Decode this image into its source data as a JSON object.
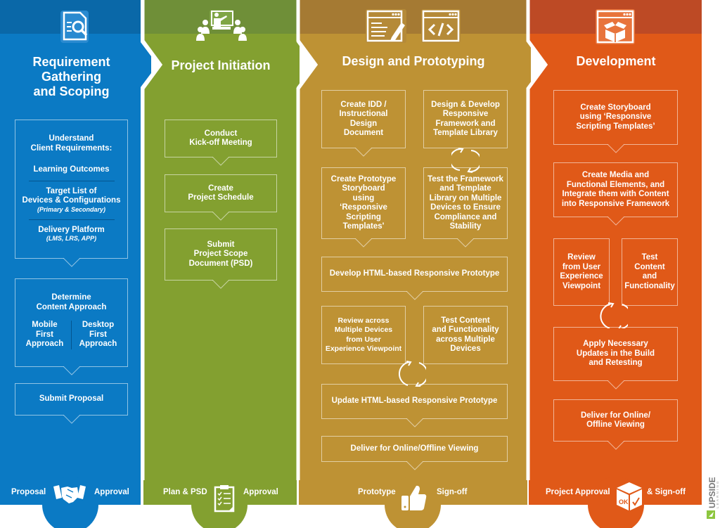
{
  "colors": {
    "blue": "#0b7ac4",
    "blue_band": "#0a68a8",
    "green": "#83a030",
    "green_band": "#6f8f38",
    "gold": "#be9234",
    "gold_band": "#a57a33",
    "orange": "#e05918",
    "orange_band": "#bd4a25",
    "logo_green": "#8dc63f",
    "logo_gray": "#888888"
  },
  "phases": [
    {
      "title_lines": [
        "Requirement",
        "Gathering",
        "and Scoping"
      ],
      "icon": "document-search-icon",
      "boxes": [
        {
          "heading": [
            "Understand",
            "Client Requirements:"
          ],
          "items": [
            {
              "label": [
                "Learning Outcomes"
              ]
            },
            {
              "label": [
                "Target List of",
                "Devices & Configurations"
              ],
              "note": "(Primary & Secondary)"
            },
            {
              "label": [
                "Delivery Platform"
              ],
              "note": "(LMS, LRS, APP)"
            }
          ]
        },
        {
          "heading": [
            "Determine",
            "Content Approach"
          ],
          "options": [
            [
              "Mobile",
              "First",
              "Approach"
            ],
            [
              "Desktop",
              "First",
              "Approach"
            ]
          ]
        },
        {
          "label": [
            "Submit Proposal"
          ]
        }
      ],
      "footer": {
        "left": "Proposal",
        "right": "Approval",
        "icon": "handshake-icon"
      }
    },
    {
      "title_lines": [
        "Project Initiation"
      ],
      "icon": "presentation-meeting-icon",
      "boxes": [
        {
          "label": [
            "Conduct",
            "Kick-off Meeting"
          ]
        },
        {
          "label": [
            "Create",
            "Project Schedule"
          ]
        },
        {
          "label": [
            "Submit",
            "Project Scope",
            "Document (PSD)"
          ]
        }
      ],
      "footer": {
        "left": "Plan & PSD",
        "right": "Approval",
        "icon": "clipboard-checklist-icon"
      }
    },
    {
      "title_lines": [
        "Design and Prototyping"
      ],
      "icons": [
        "design-window-pencil-icon",
        "code-window-icon"
      ],
      "boxes": [
        {
          "label": [
            "Create IDD /",
            "Instructional",
            "Design",
            "Document"
          ]
        },
        {
          "label": [
            "Design & Develop",
            "Responsive",
            "Framework and",
            "Template Library"
          ]
        },
        {
          "label": [
            "Create Prototype",
            "Storyboard",
            "using",
            "‘Responsive",
            "Scripting",
            "Templates'"
          ]
        },
        {
          "label": [
            "Test the Framework",
            "and Template",
            "Library on Multiple",
            "Devices to Ensure",
            "Compliance and",
            "Stability"
          ]
        },
        {
          "label": [
            "Develop HTML-based Responsive Prototype"
          ]
        },
        {
          "label": [
            "Review across",
            "Multiple Devices",
            "from User",
            "Experience Viewpoint"
          ]
        },
        {
          "label": [
            "Test Content",
            "and Functionality",
            "across Multiple",
            "Devices"
          ]
        },
        {
          "label": [
            "Update HTML-based Responsive Prototype"
          ]
        },
        {
          "label": [
            "Deliver for Online/Offline Viewing"
          ]
        }
      ],
      "footer": {
        "left": "Prototype",
        "right": "Sign-off",
        "icon": "thumbs-up-icon"
      }
    },
    {
      "title_lines": [
        "Development"
      ],
      "icon": "package-window-icon",
      "boxes": [
        {
          "label": [
            "Create Storyboard",
            "using ‘Responsive",
            "Scripting Templates’"
          ]
        },
        {
          "label": [
            "Create Media and",
            "Functional Elements, and",
            "Integrate them with Content",
            "into Responsive Framework"
          ]
        },
        {
          "label": [
            "Review",
            "from User",
            "Experience",
            "Viewpoint"
          ]
        },
        {
          "label": [
            "Test",
            "Content",
            "and",
            "Functionality"
          ]
        },
        {
          "label": [
            "Apply Necessary",
            "Updates in the Build",
            "and Retesting"
          ]
        },
        {
          "label": [
            "Deliver for Online/",
            "Offline Viewing"
          ]
        }
      ],
      "footer": {
        "left": "Project Approval",
        "right": "& Sign-off",
        "icon": "ok-check-box-icon"
      }
    }
  ],
  "logo": {
    "name": "UPSIDE",
    "sub": "LEARNING"
  }
}
